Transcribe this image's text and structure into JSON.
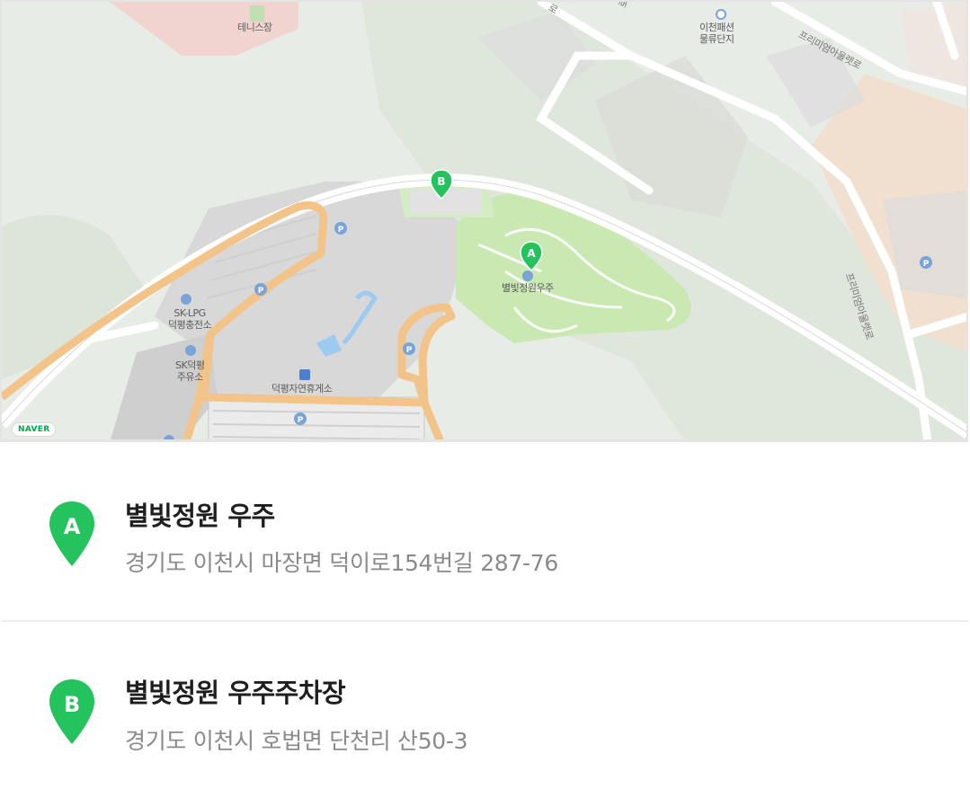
{
  "map": {
    "provider_logo": "NAVER",
    "markers": [
      {
        "letter": "A",
        "label": "별빛정원우주"
      },
      {
        "letter": "B"
      }
    ],
    "labels": {
      "tennis": "테니스장",
      "logistics": "이천패션\n물류단지",
      "lpg": "SK-LPG\n덕평충전소",
      "gas": "SK덕평\n주유소",
      "rest_area": "덕평자연휴게소",
      "road_1": "프리미엄아울렛로",
      "road_2": "프리미엄아울렛로",
      "road_3": "로",
      "road_4": "로"
    },
    "colors": {
      "marker": "#24c35e",
      "road_major": "#f3c48a",
      "park": "#c9e8b2"
    }
  },
  "places": [
    {
      "letter": "A",
      "name": "별빛정원 우주",
      "address": "경기도 이천시 마장면 덕이로154번길 287-76"
    },
    {
      "letter": "B",
      "name": "별빛정원 우주주차장",
      "address": "경기도 이천시 호법면 단천리 산50-3"
    }
  ]
}
